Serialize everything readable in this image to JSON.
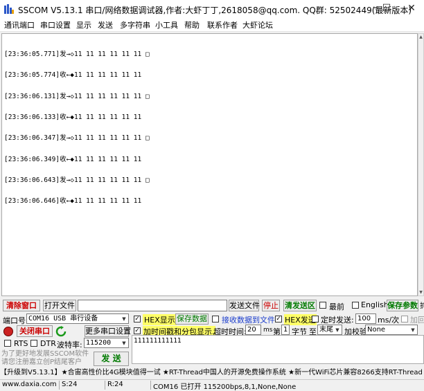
{
  "window": {
    "title": "SSCOM V5.13.1 串口/网络数据调试器,作者:大虾丁丁,2618058@qq.com. QQ群: 52502449(最新版本)",
    "minimize": "─",
    "maximize": "☐",
    "close": "✕"
  },
  "menu": [
    "通讯端口",
    "串口设置",
    "显示",
    "发送",
    "多字符串",
    "小工具",
    "帮助",
    "联系作者",
    "大虾论坛"
  ],
  "receive": {
    "lines": [
      "[23:36:05.771]发→◇11 11 11 11 11 11 □",
      "[23:36:05.774]收←◆11 11 11 11 11 11",
      "[23:36:06.131]发→◇11 11 11 11 11 11 □",
      "[23:36:06.133]收←◆11 11 11 11 11 11",
      "[23:36:06.347]发→◇11 11 11 11 11 11 □",
      "[23:36:06.349]收←◆11 11 11 11 11 11",
      "[23:36:06.643]发→◇11 11 11 11 11 11 □",
      "[23:36:06.646]收←◆11 11 11 11 11 11"
    ]
  },
  "toolbar": {
    "clear_window": "清除窗口",
    "open_file": "打开文件",
    "file_path": "",
    "send_file": "发送文件",
    "stop": "停止",
    "clear_send": "清发送区",
    "topmost": "最前",
    "english": "English",
    "save_params": "保存参数",
    "expand": "扩展",
    "expand_arrow": "—"
  },
  "port": {
    "port_label": "端口号",
    "port_value": "COM16 USB 串行设备",
    "close_port": "关闭串口",
    "more_settings": "更多串口设置",
    "rts": "RTS",
    "dtr": "DTR",
    "baud_label": "波特率:",
    "baud_value": "115200"
  },
  "options": {
    "hex_display": "HEX显示",
    "save_data": "保存数据",
    "recv_to_file": "接收数据到文件",
    "hex_send": "HEX发送",
    "timed_send": "定时发送:",
    "interval": "100",
    "interval_unit": "ms/次",
    "add_crlf": "加回",
    "timestamp": "加时间戳和分包显示.",
    "timeout_label": "超时时间:",
    "timeout_value": "20",
    "timeout_unit": "ms",
    "byte_prefix": "第",
    "byte_index": "1",
    "byte_word": "字节",
    "to": "至",
    "to_value": "末尾",
    "checksum_label": "加校验",
    "checksum_value": "None"
  },
  "send": {
    "text": "111111111111",
    "button": "发  送",
    "promo": "为了更好地发展SSCOM软件\n请您注册嘉立创P结尾客户"
  },
  "ticker": "【升级到V5.13.1】★合宙高性价比4G模块值得一试 ★RT-Thread中国人的开源免费操作系统 ★新一代WiFi芯片兼容8266支持RT-Thread",
  "status": {
    "website": "www.daxia.com",
    "sent": "S:24",
    "received": "R:24",
    "port_info": "COM16 已打开  115200bps,8,1,None,None"
  }
}
